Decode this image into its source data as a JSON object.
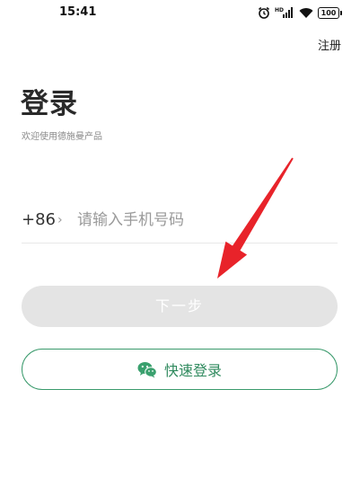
{
  "status_bar": {
    "time": "15:41",
    "battery": "100"
  },
  "header": {
    "register_label": "注册"
  },
  "main": {
    "title": "登录",
    "subtitle": "欢迎使用德施曼产品",
    "country_code": "+86",
    "country_chevron": "›",
    "phone_placeholder": "请输入手机号码",
    "phone_value": "",
    "next_label": "下一步",
    "quick_login_label": "快速登录"
  },
  "colors": {
    "accent": "#2f8a5e",
    "disabled_button": "#e4e4e4",
    "annotation_arrow": "#e8232a"
  },
  "icons": {
    "quick_login": "wechat-icon",
    "status": [
      "alarm-icon",
      "hd-signal-icon",
      "wifi-icon",
      "battery-icon"
    ]
  }
}
